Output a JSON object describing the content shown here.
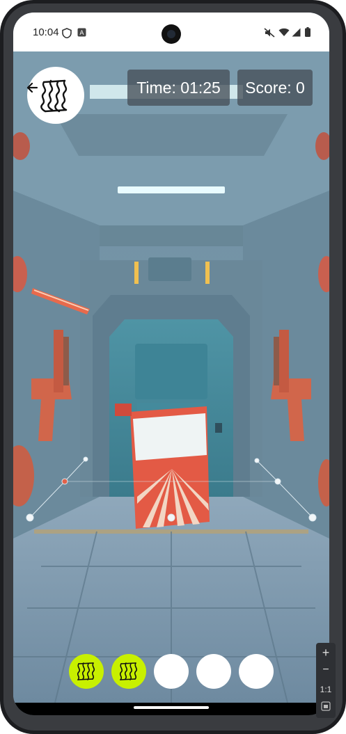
{
  "status_bar": {
    "time": "10:04",
    "icons": [
      "shield-icon",
      "a-icon",
      "mute-icon",
      "wifi-icon",
      "signal-icon",
      "battery-icon"
    ]
  },
  "hud": {
    "timer_text": "Time: 01:25",
    "score_text": "Score: 0"
  },
  "controls": {
    "back_icon": "back-arrow-icon",
    "target_icon": "bacon-icon"
  },
  "collected": {
    "total_slots": 5,
    "filled_slots": 2,
    "filled_color": "#c8f000"
  },
  "scene": {
    "description_icons": [
      "space-corridor",
      "chip-bag",
      "blaster",
      "grab-handles"
    ]
  },
  "zoom_controls": {
    "plus_label": "+",
    "minus_label": "−",
    "ratio_label": "1:1"
  }
}
